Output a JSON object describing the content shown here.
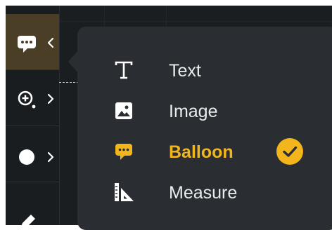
{
  "toolbar": {
    "tools": [
      {
        "name": "balloon",
        "icon": "speech-bubble-icon",
        "active": true,
        "chevron": "chevron-left-icon"
      },
      {
        "name": "zoom",
        "icon": "magnifier-plus-icon",
        "active": false,
        "chevron": "chevron-right-icon"
      },
      {
        "name": "color",
        "icon": "filled-circle-icon",
        "active": false,
        "chevron": "chevron-right-icon"
      },
      {
        "name": "draw",
        "icon": "pencil-icon",
        "active": false
      }
    ]
  },
  "menu": {
    "items": [
      {
        "label": "Text",
        "icon": "text-T-icon",
        "selected": false
      },
      {
        "label": "Image",
        "icon": "image-icon",
        "selected": false
      },
      {
        "label": "Balloon",
        "icon": "speech-bubble-icon",
        "selected": true
      },
      {
        "label": "Measure",
        "icon": "ruler-triangle-icon",
        "selected": false
      }
    ]
  },
  "colors": {
    "accent": "#f2b51c",
    "toolbar_bg": "#1a1d20",
    "popover_bg": "#2a2e32",
    "active_tool_bg": "#4a3f26",
    "text": "#e9ebed"
  }
}
